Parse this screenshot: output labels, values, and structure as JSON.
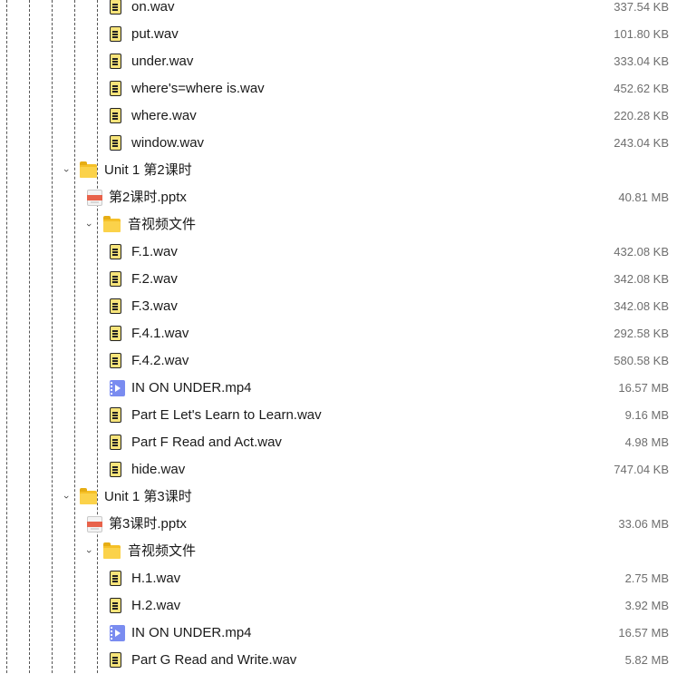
{
  "rows": [
    {
      "type": "wav",
      "indent": 2,
      "name": "on.wav",
      "size": "337.54 KB"
    },
    {
      "type": "wav",
      "indent": 2,
      "name": "put.wav",
      "size": "101.80 KB"
    },
    {
      "type": "wav",
      "indent": 2,
      "name": "under.wav",
      "size": "333.04 KB"
    },
    {
      "type": "wav",
      "indent": 2,
      "name": "where's=where is.wav",
      "size": "452.62 KB"
    },
    {
      "type": "wav",
      "indent": 2,
      "name": "where.wav",
      "size": "220.28 KB"
    },
    {
      "type": "wav",
      "indent": 2,
      "name": "window.wav",
      "size": "243.04 KB"
    },
    {
      "type": "folder",
      "indent": 0,
      "name": "Unit 1 第2课时",
      "size": ""
    },
    {
      "type": "pptx",
      "indent": 1,
      "name": "第2课时.pptx",
      "size": "40.81 MB"
    },
    {
      "type": "folder",
      "indent": 1,
      "name": "音视频文件",
      "size": ""
    },
    {
      "type": "wav",
      "indent": 2,
      "name": "F.1.wav",
      "size": "432.08 KB"
    },
    {
      "type": "wav",
      "indent": 2,
      "name": "F.2.wav",
      "size": "342.08 KB"
    },
    {
      "type": "wav",
      "indent": 2,
      "name": "F.3.wav",
      "size": "342.08 KB"
    },
    {
      "type": "wav",
      "indent": 2,
      "name": "F.4.1.wav",
      "size": "292.58 KB"
    },
    {
      "type": "wav",
      "indent": 2,
      "name": "F.4.2.wav",
      "size": "580.58 KB"
    },
    {
      "type": "mp4",
      "indent": 2,
      "name": "IN ON UNDER.mp4",
      "size": "16.57 MB"
    },
    {
      "type": "wav",
      "indent": 2,
      "name": "Part E Let's Learn to Learn.wav",
      "size": "9.16 MB"
    },
    {
      "type": "wav",
      "indent": 2,
      "name": "Part F Read and Act.wav",
      "size": "4.98 MB"
    },
    {
      "type": "wav",
      "indent": 2,
      "name": "hide.wav",
      "size": "747.04 KB"
    },
    {
      "type": "folder",
      "indent": 0,
      "name": "Unit 1 第3课时",
      "size": ""
    },
    {
      "type": "pptx",
      "indent": 1,
      "name": "第3课时.pptx",
      "size": "33.06 MB"
    },
    {
      "type": "folder",
      "indent": 1,
      "name": "音视频文件",
      "size": ""
    },
    {
      "type": "wav",
      "indent": 2,
      "name": "H.1.wav",
      "size": "2.75 MB"
    },
    {
      "type": "wav",
      "indent": 2,
      "name": "H.2.wav",
      "size": "3.92 MB"
    },
    {
      "type": "mp4",
      "indent": 2,
      "name": "IN ON UNDER.mp4",
      "size": "16.57 MB"
    },
    {
      "type": "wav",
      "indent": 2,
      "name": "Part G Read and Write.wav",
      "size": "5.82 MB"
    }
  ],
  "icons": {
    "wav": "audio-file-icon",
    "folder": "folder-icon",
    "mp4": "video-file-icon",
    "pptx": "pptx-file-icon",
    "expander": "chevron-down-icon"
  },
  "colors": {
    "folder": "#f5c027",
    "audio_file": "#f6e37a",
    "video_file": "#7a8cf0",
    "pptx_band": "#e8624a",
    "size_text": "#6e6e6e"
  }
}
